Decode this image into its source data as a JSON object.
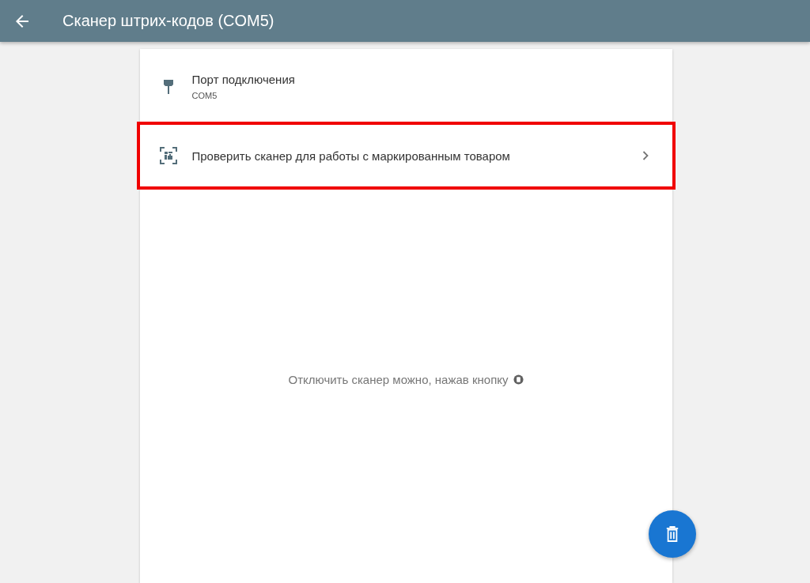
{
  "window": {
    "title": "Сканер штрих-кодов (COM5)"
  },
  "items": [
    {
      "kind": "port",
      "title": "Порт подключения",
      "subtitle": "COM5",
      "highlighted": false
    },
    {
      "kind": "check",
      "title": "Проверить сканер для работы с маркированным товаром",
      "highlighted": true
    }
  ],
  "hint": "Отключить сканер можно, нажав кнопку"
}
